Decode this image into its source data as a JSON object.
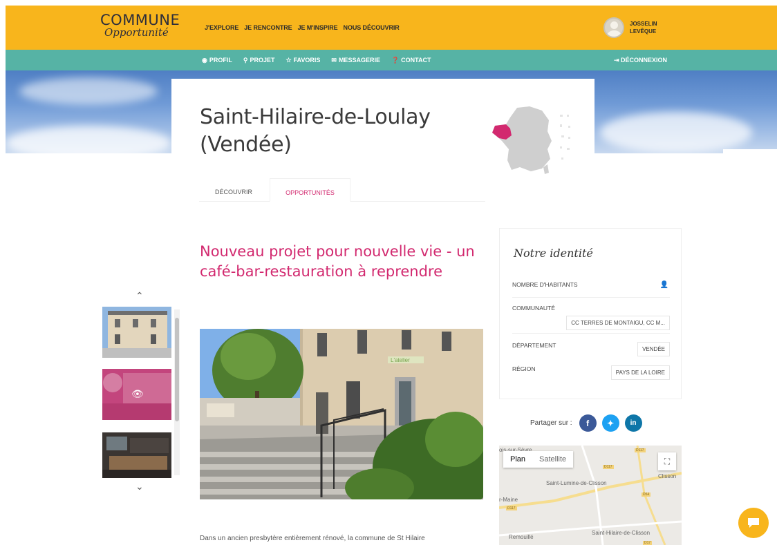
{
  "header": {
    "logo_main": "COMMUNE",
    "logo_sub": "Opportunité",
    "nav": [
      "J'EXPLORE",
      "JE RENCONTRE",
      "JE M'INSPIRE",
      "NOUS DÉCOUVRIR"
    ],
    "user_first": "JOSSELIN",
    "user_last": "LEVÊQUE"
  },
  "subnav": {
    "items": [
      {
        "icon": "user-circle-icon",
        "label": "PROFIL"
      },
      {
        "icon": "map-pin-icon",
        "label": "PROJET"
      },
      {
        "icon": "star-icon",
        "label": "FAVORIS"
      },
      {
        "icon": "envelope-icon",
        "label": "MESSAGERIE"
      },
      {
        "icon": "question-icon",
        "label": "CONTACT"
      }
    ],
    "logout": "DÉCONNEXION"
  },
  "page": {
    "title_line1": "Saint-Hilaire-de-Loulay",
    "title_line2": "(Vendée)",
    "tabs": [
      "DÉCOUVRIR",
      "OPPORTUNITÉS"
    ],
    "active_tab": "OPPORTUNITÉS",
    "project_title": "Nouveau projet pour nouvelle vie - un café-bar-restauration à reprendre",
    "body_start": "Dans un ancien presbytère entièrement rénové, la commune de St Hilaire",
    "photo_sign": "L'atelier"
  },
  "identity": {
    "title": "Notre identité",
    "rows": [
      {
        "label": "NOMBRE D'HABITANTS",
        "value": ""
      },
      {
        "label": "COMMUNAUTÉ",
        "value": "CC TERRES DE MONTAIGU, CC M..."
      },
      {
        "label": "DÉPARTEMENT",
        "value": "VENDÉE"
      },
      {
        "label": "RÉGION",
        "value": "PAYS DE LA LOIRE"
      }
    ]
  },
  "share": {
    "label": "Partager sur :",
    "networks": [
      "f",
      "t",
      "in"
    ]
  },
  "map": {
    "tabs": [
      "Plan",
      "Satellite"
    ],
    "labels": [
      "ois-sur-Sèvre",
      "Clisson",
      "Saint-Lumine-de-Clisson",
      "r-Maine",
      "Remouillé",
      "Saint-Hilaire-de-Clisson"
    ],
    "roads": [
      "D117",
      "D117",
      "D117",
      "D54",
      "D17"
    ]
  },
  "colors": {
    "accent": "#f8b51c",
    "teal": "#56b3a5",
    "pink": "#d2296f"
  }
}
